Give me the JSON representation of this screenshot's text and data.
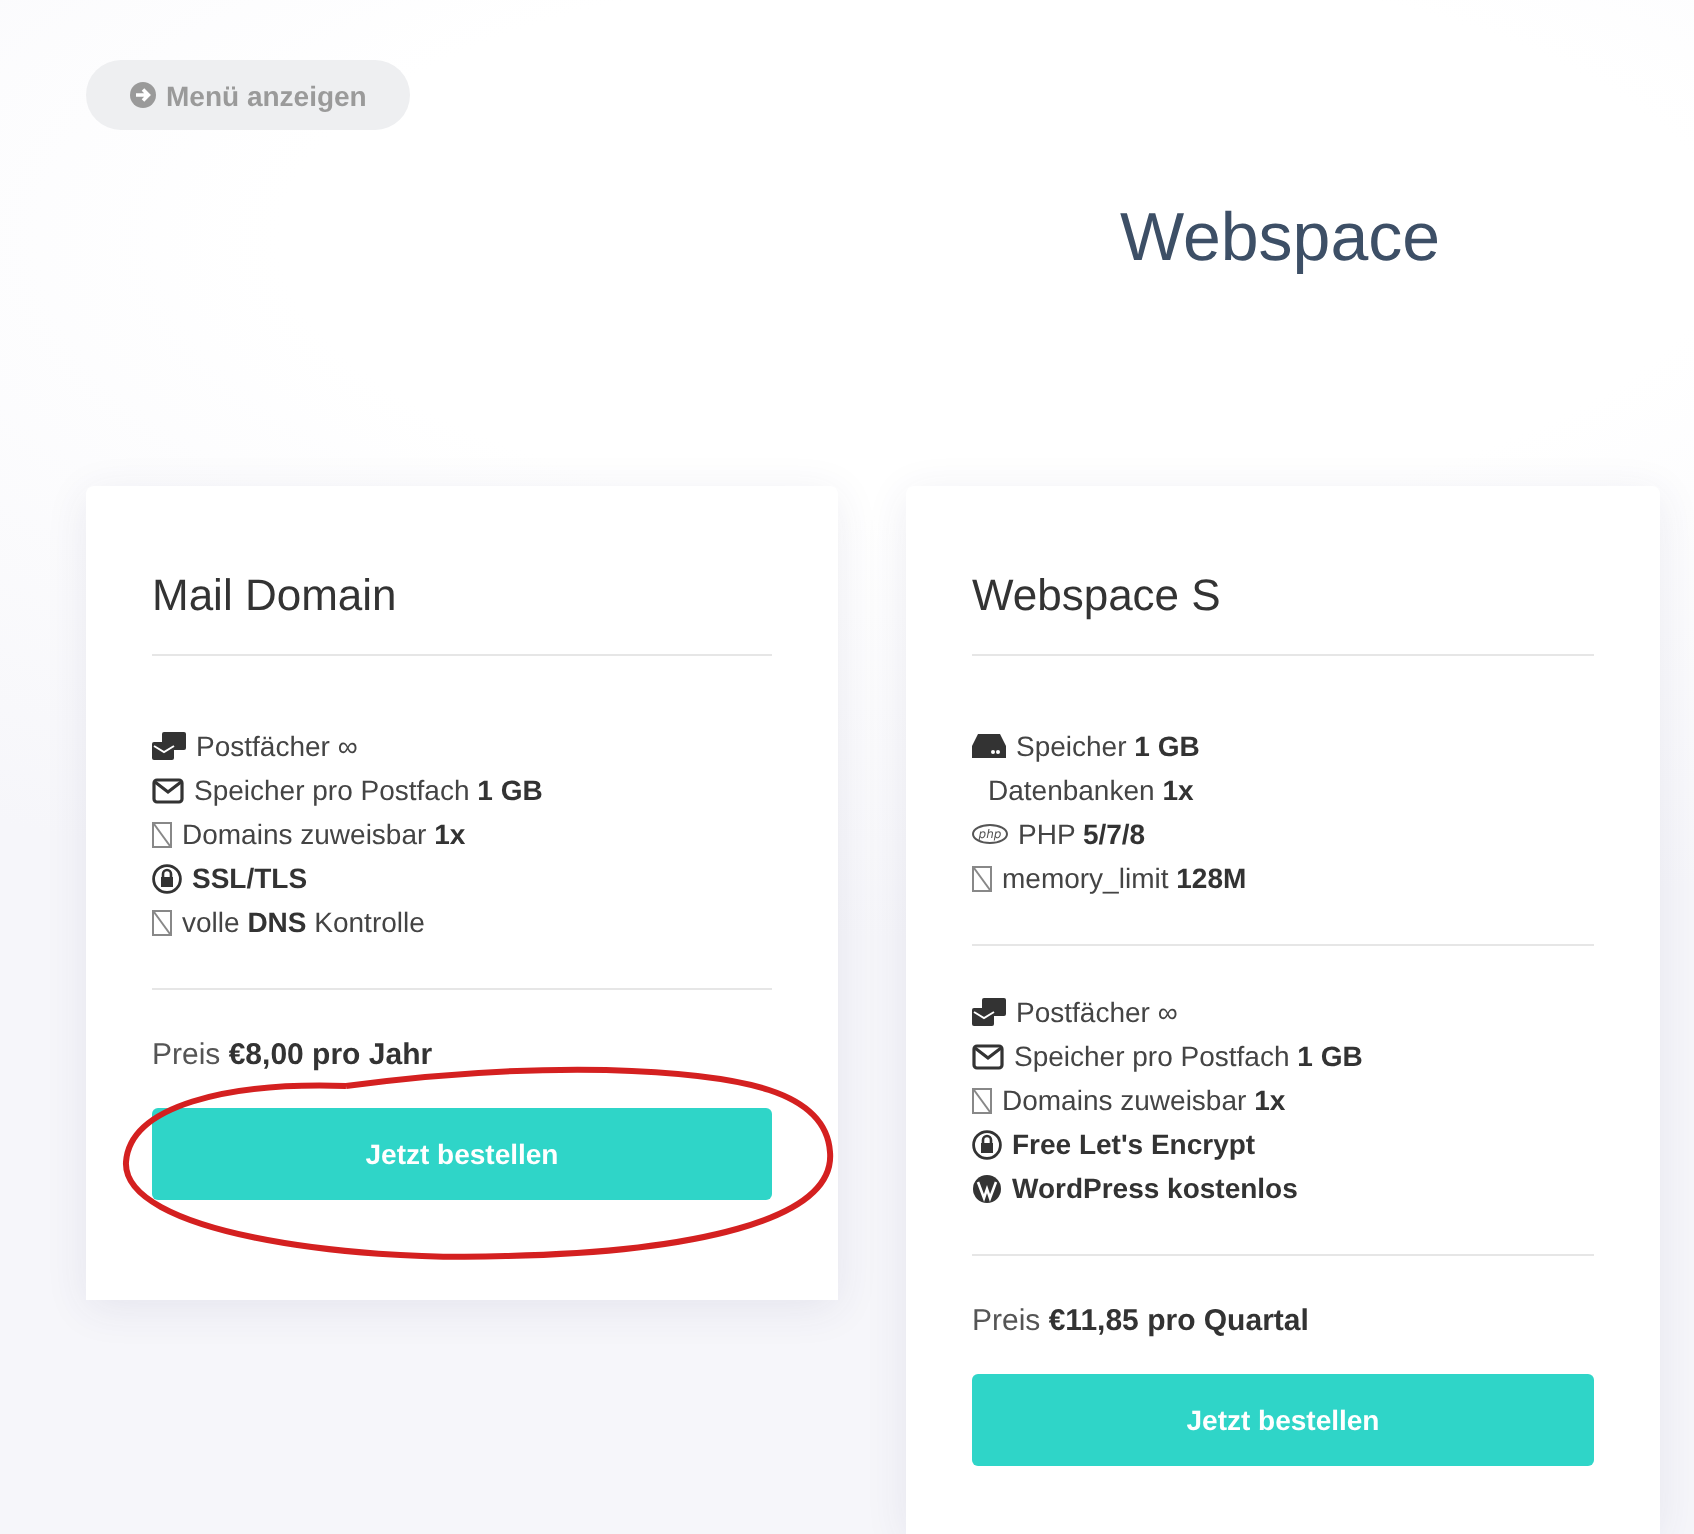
{
  "menu_button": {
    "label": "Menü anzeigen"
  },
  "heading": "Webspace",
  "plans": [
    {
      "title": "Mail Domain",
      "circled": true,
      "feature_groups": [
        [
          {
            "kind": "inbox",
            "text": "Postfächer ∞",
            "strong": false
          },
          {
            "kind": "envelope",
            "text": "Speicher pro Postfach **1 GB**",
            "strong": false
          },
          {
            "kind": "missing",
            "text": "Domains zuweisbar **1x**",
            "strong": false
          },
          {
            "kind": "lock",
            "text": "SSL/TLS",
            "strong": true
          },
          {
            "kind": "missing",
            "text": "volle **DNS** Kontrolle",
            "strong": false
          }
        ]
      ],
      "price": "Preis **€8,00 pro Jahr**",
      "button": "Jetzt bestellen"
    },
    {
      "title": "Webspace S",
      "circled": false,
      "feature_groups": [
        [
          {
            "kind": "drive",
            "text": "Speicher **1 GB**",
            "strong": false
          },
          {
            "kind": "plain",
            "text": "Datenbanken **1x**",
            "strong": false
          },
          {
            "kind": "php",
            "text": "PHP **5/7/8**",
            "strong": false
          },
          {
            "kind": "missing",
            "text": "memory_limit **128M**",
            "strong": false
          }
        ],
        [
          {
            "kind": "inbox",
            "text": "Postfächer ∞",
            "strong": false
          },
          {
            "kind": "envelope",
            "text": "Speicher pro Postfach **1 GB**",
            "strong": false
          },
          {
            "kind": "missing",
            "text": "Domains zuweisbar **1x**",
            "strong": false
          },
          {
            "kind": "lock",
            "text": "Free Let's Encrypt",
            "strong": true
          },
          {
            "kind": "wordpress",
            "text": "WordPress kostenlos",
            "strong": true
          }
        ]
      ],
      "price": "Preis **€11,85 pro Quartal**",
      "button": "Jetzt bestellen"
    }
  ]
}
